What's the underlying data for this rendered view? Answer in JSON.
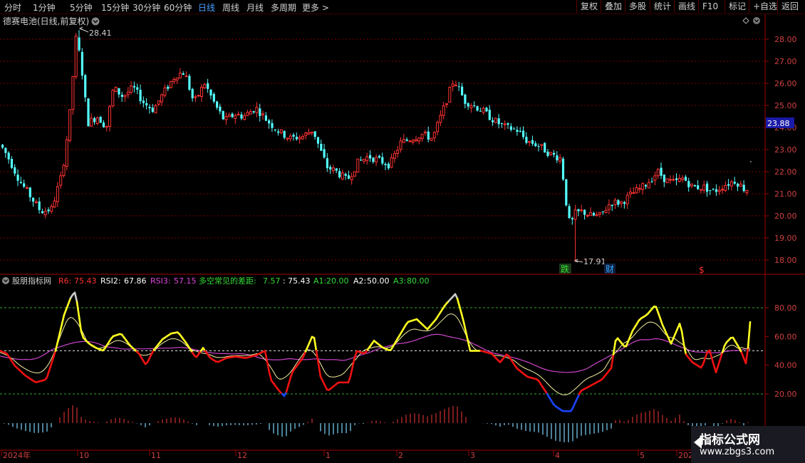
{
  "toolbar": {
    "timeframes": [
      "分时",
      "1分钟",
      "5分钟",
      "15分钟",
      "30分钟",
      "60分钟",
      "日线",
      "周线",
      "月线",
      "多周期",
      "更多"
    ],
    "more_arrow": ">",
    "active": "日线",
    "tools": [
      "复权",
      "叠加",
      "多股",
      "统计",
      "画线",
      "F10",
      "标记",
      "+自选",
      "返回"
    ]
  },
  "main_chart": {
    "title": "德赛电池(日线,前复权)",
    "high_label": "28.41",
    "low_label": "17.91",
    "price_tag": "23.88",
    "y_ticks": [
      "28.00",
      "27.00",
      "26.00",
      "25.00",
      "24.00",
      "23.00",
      "22.00",
      "21.00",
      "20.00",
      "19.00",
      "18.00"
    ],
    "markers": [
      {
        "text": "跌",
        "color": "#33dd33"
      },
      {
        "text": "财",
        "color": "#33aaff"
      },
      {
        "text": "$",
        "color": "#ff3333"
      }
    ]
  },
  "indicator": {
    "name": "股朋指标网",
    "values": [
      {
        "label": "R6:",
        "value": "75.43",
        "color": "#ff3333"
      },
      {
        "label": "RSI2:",
        "value": "67.86",
        "color": "#ffffff"
      },
      {
        "label": "RSI3:",
        "value": "57.15",
        "color": "#dd44dd"
      },
      {
        "label": "多空常见的差距:",
        "value": "7.57",
        "color": "#33dd33"
      },
      {
        "label": ":",
        "value": "75.43",
        "color": "#ffffff"
      },
      {
        "label": "A1:",
        "value": "20.00",
        "color": "#33dd33"
      },
      {
        "label": "A2:",
        "value": "50.00",
        "color": "#ffffff"
      },
      {
        "label": "A3:",
        "value": "80.00",
        "color": "#33dd33"
      }
    ],
    "y_ticks": [
      "80.00",
      "60.00",
      "40.00",
      "20.00"
    ]
  },
  "x_axis": {
    "labels": [
      "2024年",
      "10",
      "11",
      "12",
      "1",
      "2",
      "3",
      "4",
      "5",
      "202"
    ]
  },
  "watermark": {
    "line1": "指标公式网",
    "line2": "www.zbgs3.com"
  },
  "colors": {
    "up": "#ff3333",
    "down": "#54ffff",
    "grid": "#7a0000",
    "axis": "#a00000"
  }
}
